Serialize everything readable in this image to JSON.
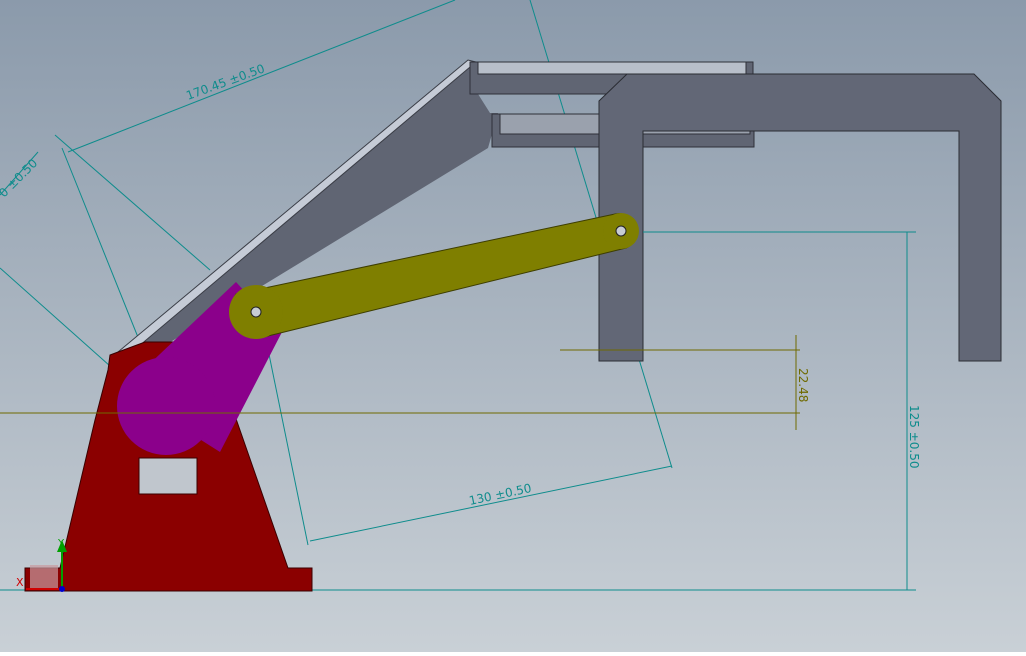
{
  "colors": {
    "bg_top": "#8b9aab",
    "bg_bottom": "#c9d0d6",
    "dimension_teal": "#0e8c8c",
    "dimension_olive": "#6f6a00",
    "base_red": "#8b0000",
    "link_purple": "#8b008b",
    "arm_olive": "#7f7f00",
    "arm_gray": "#606573",
    "gripper_gray": "#626776",
    "axis_x": "#d00000",
    "axis_y": "#00a000",
    "axis_z": "#0000cc"
  },
  "dimensions": {
    "d1": "170.45 ±0.50",
    "d2": "0 ±0.50",
    "d3": "130 ±0.50",
    "d4": "22.48",
    "d5": "125 ±0.50"
  },
  "triad": {
    "x": "X",
    "y": "Y"
  }
}
